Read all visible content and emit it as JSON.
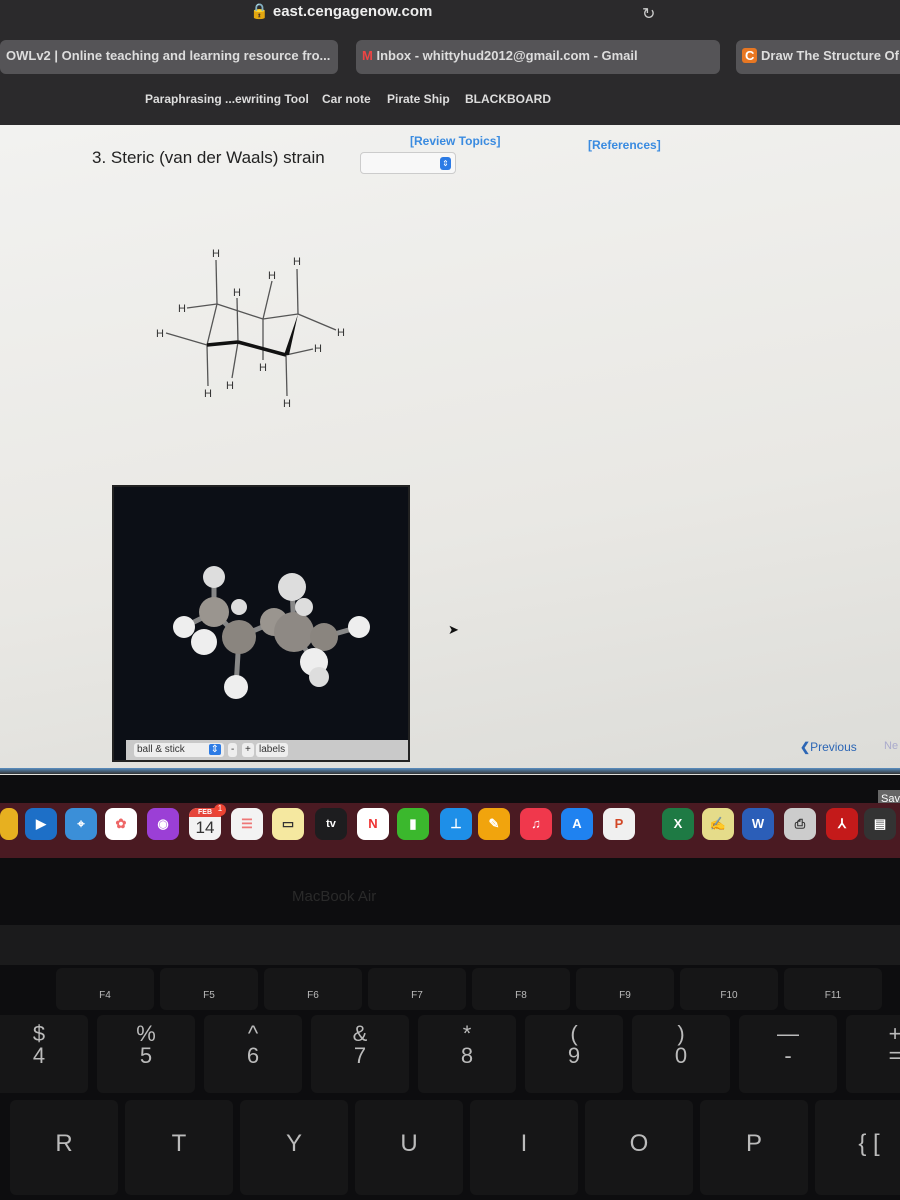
{
  "browser": {
    "url": "east.cengagenow.com",
    "tabs": [
      "OWLv2 | Online teaching and learning resource fro...",
      "Inbox - whittyhud2012@gmail.com - Gmail",
      "Draw The Structure Of"
    ],
    "bookmarks": [
      "Paraphrasing ...ewriting Tool",
      "Car note",
      "Pirate Ship",
      "BLACKBOARD"
    ]
  },
  "page": {
    "review_topics": "[Review Topics]",
    "references": "[References]",
    "question": "3. Steric (van der Waals) strain",
    "select_value": "",
    "atom_label": "H",
    "viewer": {
      "mode": "ball & stick",
      "minus": "-",
      "plus": "+",
      "labels": "labels"
    },
    "previous": "Previous",
    "next": "Ne",
    "save": "Sav"
  },
  "dock": {
    "calendar_month": "FEB",
    "calendar_day": "14",
    "calendar_badge": "1",
    "tv": "tv",
    "word": "W",
    "excel": "X",
    "ppt": "P"
  },
  "laptop": {
    "brand": "MacBook Air"
  },
  "keyboard": {
    "fn": [
      "F4",
      "F5",
      "F6",
      "F7",
      "F8",
      "F9",
      "F10",
      "F11"
    ],
    "num": [
      [
        "$",
        "4"
      ],
      [
        "%",
        "5"
      ],
      [
        "^",
        "6"
      ],
      [
        "&",
        "7"
      ],
      [
        "*",
        "8"
      ],
      [
        "(",
        "9"
      ],
      [
        ")",
        "0"
      ],
      [
        "—",
        "-"
      ],
      [
        "+",
        "="
      ]
    ],
    "letters": [
      "R",
      "T",
      "Y",
      "U",
      "I",
      "O",
      "P",
      "{ ["
    ]
  }
}
